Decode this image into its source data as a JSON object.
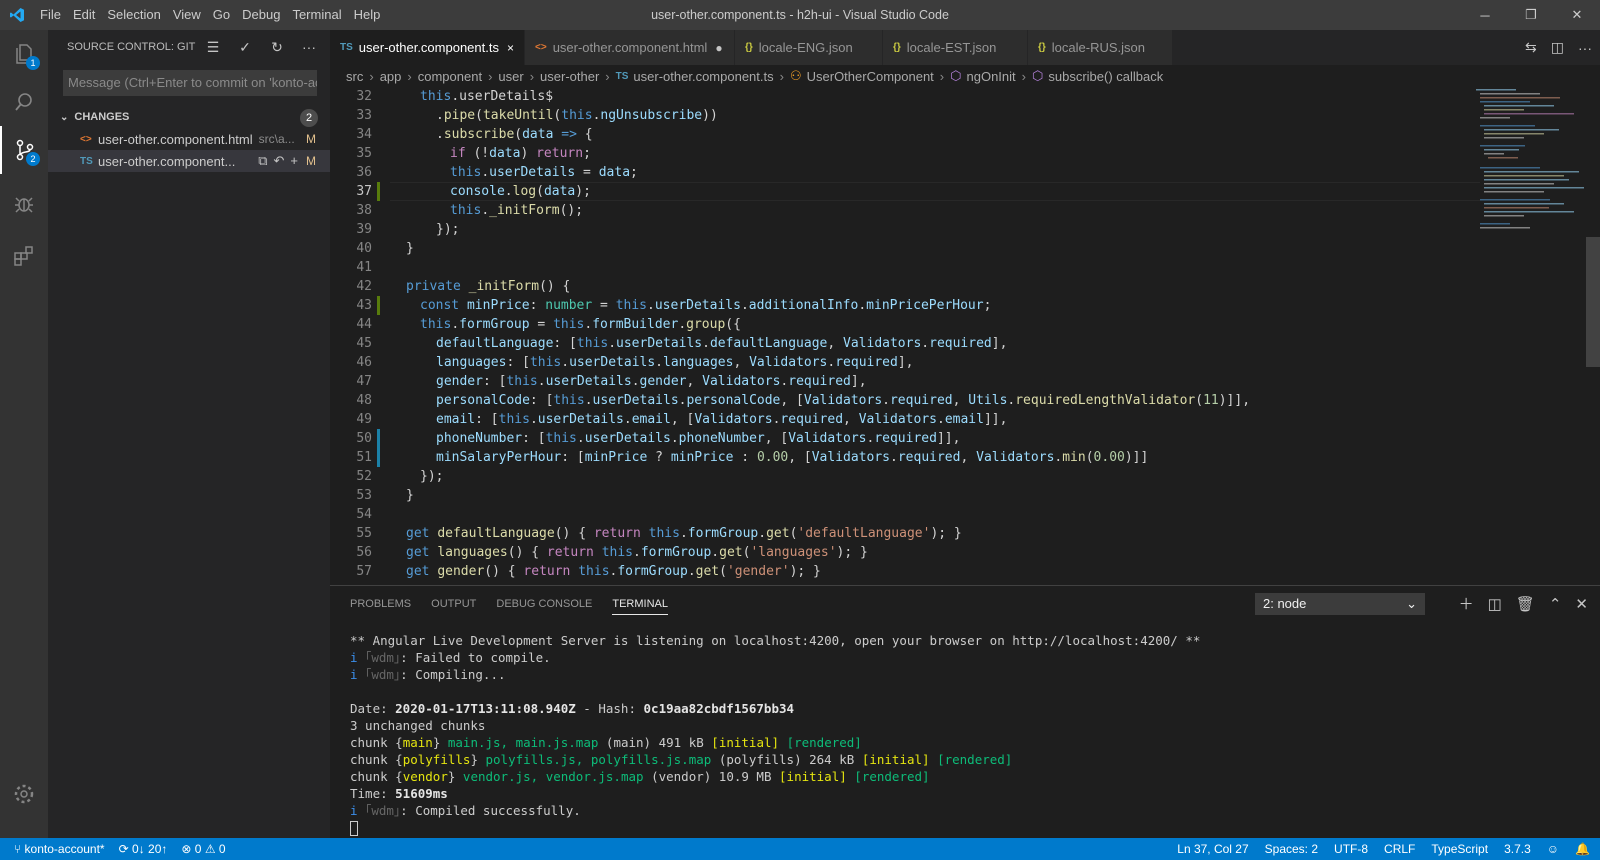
{
  "window": {
    "title": "user-other.component.ts - h2h-ui - Visual Studio Code",
    "menu": [
      "File",
      "Edit",
      "Selection",
      "View",
      "Go",
      "Debug",
      "Terminal",
      "Help"
    ]
  },
  "activity_bar": {
    "explorer_badge": "1",
    "scm_badge": "2"
  },
  "sidebar": {
    "title": "SOURCE CONTROL: GIT",
    "commit_placeholder": "Message (Ctrl+Enter to commit on 'konto-account')",
    "changes_label": "CHANGES",
    "changes_count": "2",
    "files": [
      {
        "icon": "<>",
        "name": "user-other.component.html",
        "path": "src\\a...",
        "status": "M"
      },
      {
        "icon": "TS",
        "name": "user-other.component...",
        "path": "",
        "status": "M"
      }
    ]
  },
  "tabs": [
    {
      "icon": "TS",
      "label": "user-other.component.ts",
      "close": "×"
    },
    {
      "icon": "<>",
      "label": "user-other.component.html",
      "close": "●"
    },
    {
      "icon": "{}",
      "label": "locale-ENG.json",
      "close": ""
    },
    {
      "icon": "{}",
      "label": "locale-EST.json",
      "close": ""
    },
    {
      "icon": "{}",
      "label": "locale-RUS.json",
      "close": ""
    }
  ],
  "breadcrumb": [
    "src",
    "app",
    "component",
    "user",
    "user-other",
    "user-other.component.ts",
    "UserOtherComponent",
    "ngOnInit",
    "subscribe() callback"
  ],
  "editor": {
    "line_numbers": [
      "32",
      "33",
      "34",
      "35",
      "36",
      "37",
      "38",
      "39",
      "40",
      "41",
      "42",
      "43",
      "44",
      "45",
      "46",
      "47",
      "48",
      "49",
      "50",
      "51",
      "52",
      "53",
      "54",
      "55",
      "56",
      "57"
    ],
    "lines": {
      "l32": "this.userDetails$",
      "l33a": ".pipe(takeUntil(this.ngUnsubscribe))",
      "l34a": ".subscribe(data => {",
      "l35": "if (!data) return;",
      "l36": "this.userDetails = data;",
      "l37": "console.log(data);",
      "l38": "this._initForm();",
      "l39": "});",
      "l40": "}",
      "l42": "private _initForm() {",
      "l43": "const minPrice: number = this.userDetails.additionalInfo.minPricePerHour;",
      "l44": "this.formGroup = this.formBuilder.group({",
      "l45": "defaultLanguage: [this.userDetails.defaultLanguage, Validators.required],",
      "l46": "languages: [this.userDetails.languages, Validators.required],",
      "l47": "gender: [this.userDetails.gender, Validators.required],",
      "l48": "personalCode: [this.userDetails.personalCode, [Validators.required, Utils.requiredLengthValidator(11)]],",
      "l49": "email: [this.userDetails.email, [Validators.required, Validators.email]],",
      "l50": "phoneNumber: [this.userDetails.phoneNumber, [Validators.required]],",
      "l51": "minSalaryPerHour: [minPrice ? minPrice : 0.00, [Validators.required, Validators.min(0.00)]]",
      "l52": "});",
      "l53": "}",
      "l55": "get defaultLanguage() { return this.formGroup.get('defaultLanguage'); }",
      "l56": "get languages() { return this.formGroup.get('languages'); }",
      "l57": "get gender() { return this.formGroup.get('gender'); }"
    }
  },
  "panel": {
    "tabs": [
      "PROBLEMS",
      "OUTPUT",
      "DEBUG CONSOLE",
      "TERMINAL"
    ],
    "active_tab": "TERMINAL",
    "terminal_select": "2: node",
    "terminal": {
      "l1": "** Angular Live Development Server is listening on localhost:4200, open your browser on http://localhost:4200/ **",
      "wdm_i": "i",
      "wdm_tag": "｢wdm｣",
      "l2": ": Failed to compile.",
      "l3": ": Compiling...",
      "l5_label": "Date: ",
      "l5_date": "2020-01-17T13:11:08.940Z",
      "l5_hash_label": " - Hash: ",
      "l5_hash": "0c19aa82cbdf1567bb34",
      "l6": "3 unchanged chunks",
      "chunk_word": "chunk",
      "c1_name": "main",
      "c1_files": "main.js, main.js.map",
      "c1_rest": "(main) 491 kB",
      "c2_name": "polyfills",
      "c2_files": "polyfills.js, polyfills.js.map",
      "c2_rest": "(polyfills) 264 kB",
      "c3_name": "vendor",
      "c3_files": "vendor.js, vendor.js.map",
      "c3_rest": "(vendor) 10.9 MB",
      "initial": "[initial]",
      "rendered": "[rendered]",
      "time_label": "Time: ",
      "time_value": "51609ms",
      "l11": ": Compiled successfully."
    }
  },
  "statusbar": {
    "branch": "konto-account*",
    "sync": "0↓ 20↑",
    "errors": "0",
    "warnings": "0",
    "position": "Ln 37, Col 27",
    "spaces": "Spaces: 2",
    "encoding": "UTF-8",
    "eol": "CRLF",
    "language": "TypeScript",
    "version": "3.7.3"
  },
  "colors": {
    "accent": "#007acc",
    "titlebar": "#3c3c3c",
    "editor_bg": "#1e1e1e",
    "modified": "#e2c08d"
  }
}
